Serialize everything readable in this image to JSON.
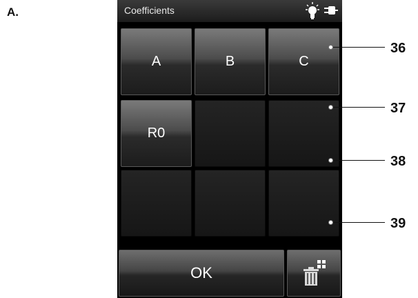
{
  "figure_label": "A.",
  "statusbar": {
    "title": "Coefficients",
    "icons": [
      "lightbulb-icon",
      "plug-icon"
    ]
  },
  "keys": [
    "A",
    "B",
    "C",
    "R0",
    "",
    "",
    "",
    "",
    ""
  ],
  "ok_label": "OK",
  "delete_icon": "trash-icon",
  "callouts": [
    "36",
    "37",
    "38",
    "39"
  ],
  "colors": {
    "accent_text": "#ffffff",
    "bulb": "#ffffff"
  }
}
